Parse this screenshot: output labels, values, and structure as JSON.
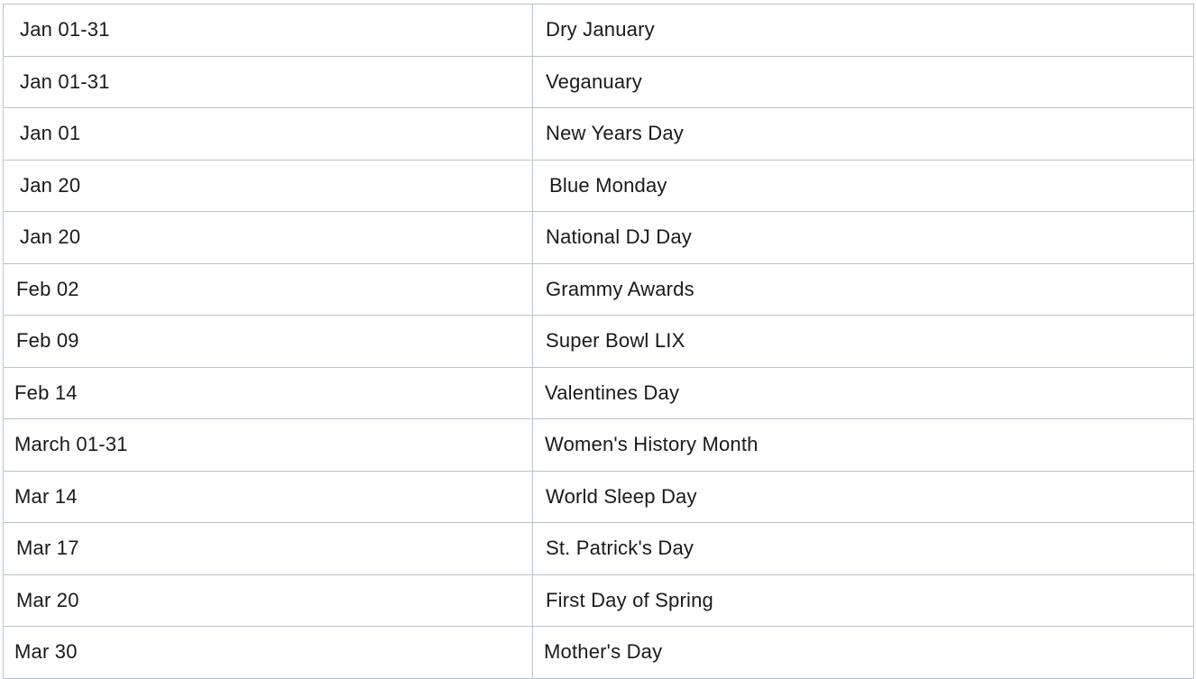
{
  "events": [
    {
      "date": "Jan 01-31",
      "name": "Dry January"
    },
    {
      "date": "Jan 01-31",
      "name": "Veganuary"
    },
    {
      "date": "Jan 01",
      "name": "New Years Day"
    },
    {
      "date": "Jan 20",
      "name": "Blue Monday"
    },
    {
      "date": "Jan 20",
      "name": "National DJ Day"
    },
    {
      "date": "Feb 02",
      "name": "Grammy Awards"
    },
    {
      "date": "Feb 09",
      "name": "Super Bowl LIX"
    },
    {
      "date": "Feb 14",
      "name": "Valentines Day"
    },
    {
      "date": "March 01-31",
      "name": "Women's History Month"
    },
    {
      "date": "Mar 14",
      "name": "World Sleep Day"
    },
    {
      "date": "Mar 17",
      "name": "St. Patrick's Day"
    },
    {
      "date": "Mar 20",
      "name": "First Day of Spring"
    },
    {
      "date": "Mar 30",
      "name": "Mother's Day"
    }
  ]
}
